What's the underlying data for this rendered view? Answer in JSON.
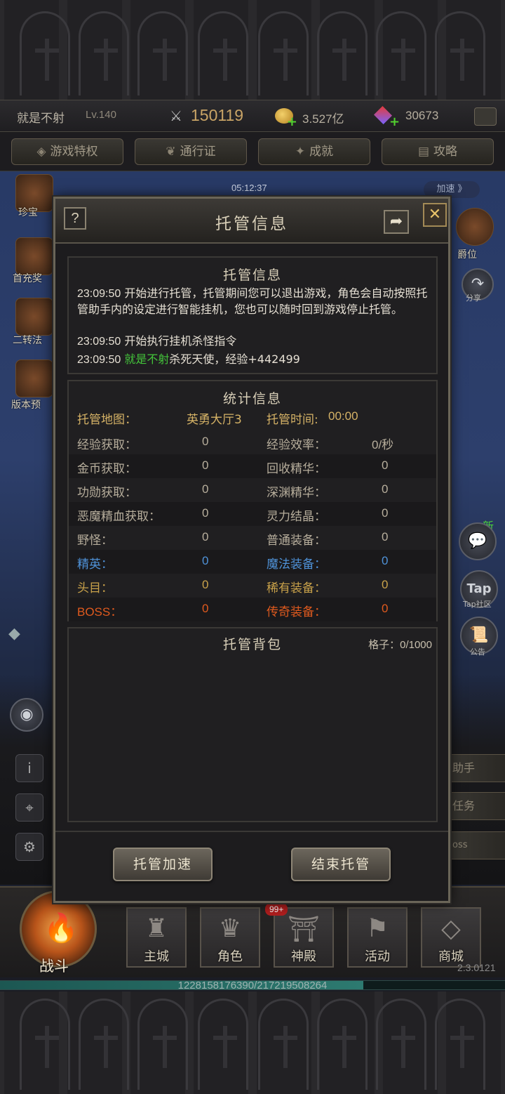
{
  "top_bar": {
    "player_name": "就是不射",
    "level": "Lv.140",
    "power": "150119",
    "gold": "3.527亿",
    "gems": "30673"
  },
  "menu": {
    "tabs": [
      "游戏特权",
      "通行证",
      "成就",
      "攻略"
    ]
  },
  "scene": {
    "timer": "05:12:37",
    "speed_label": "加速 》",
    "left_items": [
      "珍宝",
      "首充奖",
      "二转法",
      "版本预"
    ],
    "right_items": [
      "爵位",
      "分享",
      "Tap社区",
      "公告"
    ],
    "new_badge": "新",
    "right_tags": [
      "助手",
      "任务",
      "oss"
    ]
  },
  "modal": {
    "title": "托管信息",
    "help_symbol": "?",
    "close_symbol": "✕",
    "log": {
      "title": "托管信息",
      "lines": [
        {
          "time": "23:09:50",
          "text": " 开始进行托管，托管期间您可以退出游戏，角色会自动按照托管助手内的设定进行智能挂机，您也可以随时回到游戏停止托管。"
        },
        {
          "time": "23:09:50",
          "text": " 开始执行挂机杀怪指令"
        },
        {
          "time": "23:09:50",
          "player": " 就是不射",
          "text": "杀死天使，经验+442499"
        }
      ]
    },
    "stats": {
      "title": "统计信息",
      "map_label": "托管地图：",
      "map_value": "英勇大厅3",
      "time_label": "托管时间:",
      "time_value": "00:00",
      "rows": [
        {
          "l": "经验获取：",
          "lv": "0",
          "r": "经验效率：",
          "rv": "0/秒"
        },
        {
          "l": "金币获取：",
          "lv": "0",
          "r": "回收精华：",
          "rv": "0"
        },
        {
          "l": "功勋获取：",
          "lv": "0",
          "r": "深渊精华：",
          "rv": "0"
        },
        {
          "l": "恶魔精血获取：",
          "lv": "0",
          "r": "灵力结晶：",
          "rv": "0"
        },
        {
          "l": "野怪：",
          "lv": "0",
          "r": "普通装备：",
          "rv": "0"
        },
        {
          "l": "精英：",
          "lv": "0",
          "r": "魔法装备：",
          "rv": "0"
        },
        {
          "l": "头目：",
          "lv": "0",
          "r": "稀有装备：",
          "rv": "0"
        },
        {
          "l": "BOSS：",
          "lv": "0",
          "r": "传奇装备：",
          "rv": "0"
        }
      ]
    },
    "bag": {
      "title": "托管背包",
      "capacity_label": "格子：",
      "capacity_value": "0/1000"
    },
    "buttons": {
      "speed_up": "托管加速",
      "end": "结束托管"
    }
  },
  "bottom_nav": {
    "battle": "战斗",
    "items": [
      "主城",
      "角色",
      "神殿",
      "活动",
      "商城"
    ],
    "badge": "99+",
    "version": "2.3.0121",
    "exp_text": "1228158176390/217219508264",
    "exp_fraction": 0.72
  },
  "colors": {
    "accent_gold": "#d5b266",
    "elite_blue": "#4f92d8",
    "boss_orange": "#e05a1e",
    "player_green": "#43c43a"
  }
}
